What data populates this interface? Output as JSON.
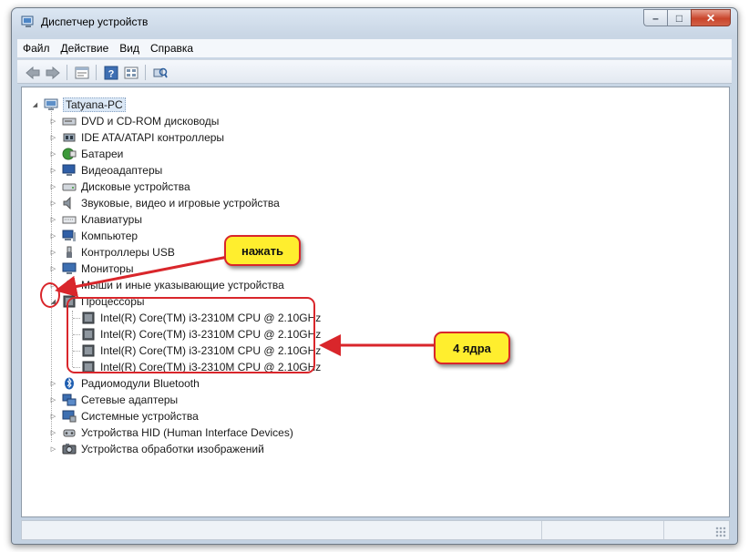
{
  "window": {
    "title": "Диспетчер устройств",
    "buttons": {
      "minimize": "–",
      "maximize": "□",
      "close": "✕"
    }
  },
  "menu": [
    "Файл",
    "Действие",
    "Вид",
    "Справка"
  ],
  "toolbar": [
    "back-icon",
    "forward-icon",
    "properties-icon",
    "help-icon",
    "view-icon",
    "scan-hardware-icon"
  ],
  "tree": {
    "root": "Tatyana-PC",
    "categories": [
      {
        "label": "DVD и CD-ROM дисководы",
        "icon": "dvd-drive-icon"
      },
      {
        "label": "IDE ATA/ATAPI контроллеры",
        "icon": "ide-controller-icon"
      },
      {
        "label": "Батареи",
        "icon": "battery-icon"
      },
      {
        "label": "Видеоадаптеры",
        "icon": "display-adapter-icon"
      },
      {
        "label": "Дисковые устройства",
        "icon": "disk-drive-icon"
      },
      {
        "label": "Звуковые, видео и игровые устройства",
        "icon": "sound-icon"
      },
      {
        "label": "Клавиатуры",
        "icon": "keyboard-icon"
      },
      {
        "label": "Компьютер",
        "icon": "computer-icon"
      },
      {
        "label": "Контроллеры USB",
        "icon": "usb-icon"
      },
      {
        "label": "Мониторы",
        "icon": "monitor-icon"
      },
      {
        "label": "Мыши и иные указывающие устройства",
        "icon": "mouse-icon"
      },
      {
        "label": "Процессоры",
        "icon": "processor-icon",
        "expanded": true,
        "children": [
          "Intel(R) Core(TM) i3-2310M CPU @ 2.10GHz",
          "Intel(R) Core(TM) i3-2310M CPU @ 2.10GHz",
          "Intel(R) Core(TM) i3-2310M CPU @ 2.10GHz",
          "Intel(R) Core(TM) i3-2310M CPU @ 2.10GHz"
        ]
      },
      {
        "label": "Радиомодули Bluetooth",
        "icon": "bluetooth-icon"
      },
      {
        "label": "Сетевые адаптеры",
        "icon": "network-adapter-icon"
      },
      {
        "label": "Системные устройства",
        "icon": "system-devices-icon"
      },
      {
        "label": "Устройства HID (Human Interface Devices)",
        "icon": "hid-icon"
      },
      {
        "label": "Устройства обработки изображений",
        "icon": "imaging-icon"
      }
    ]
  },
  "annotations": {
    "press": "нажать",
    "cores": "4 ядра",
    "accent": "#d9262b",
    "callout_fill": "#ffee2e"
  }
}
